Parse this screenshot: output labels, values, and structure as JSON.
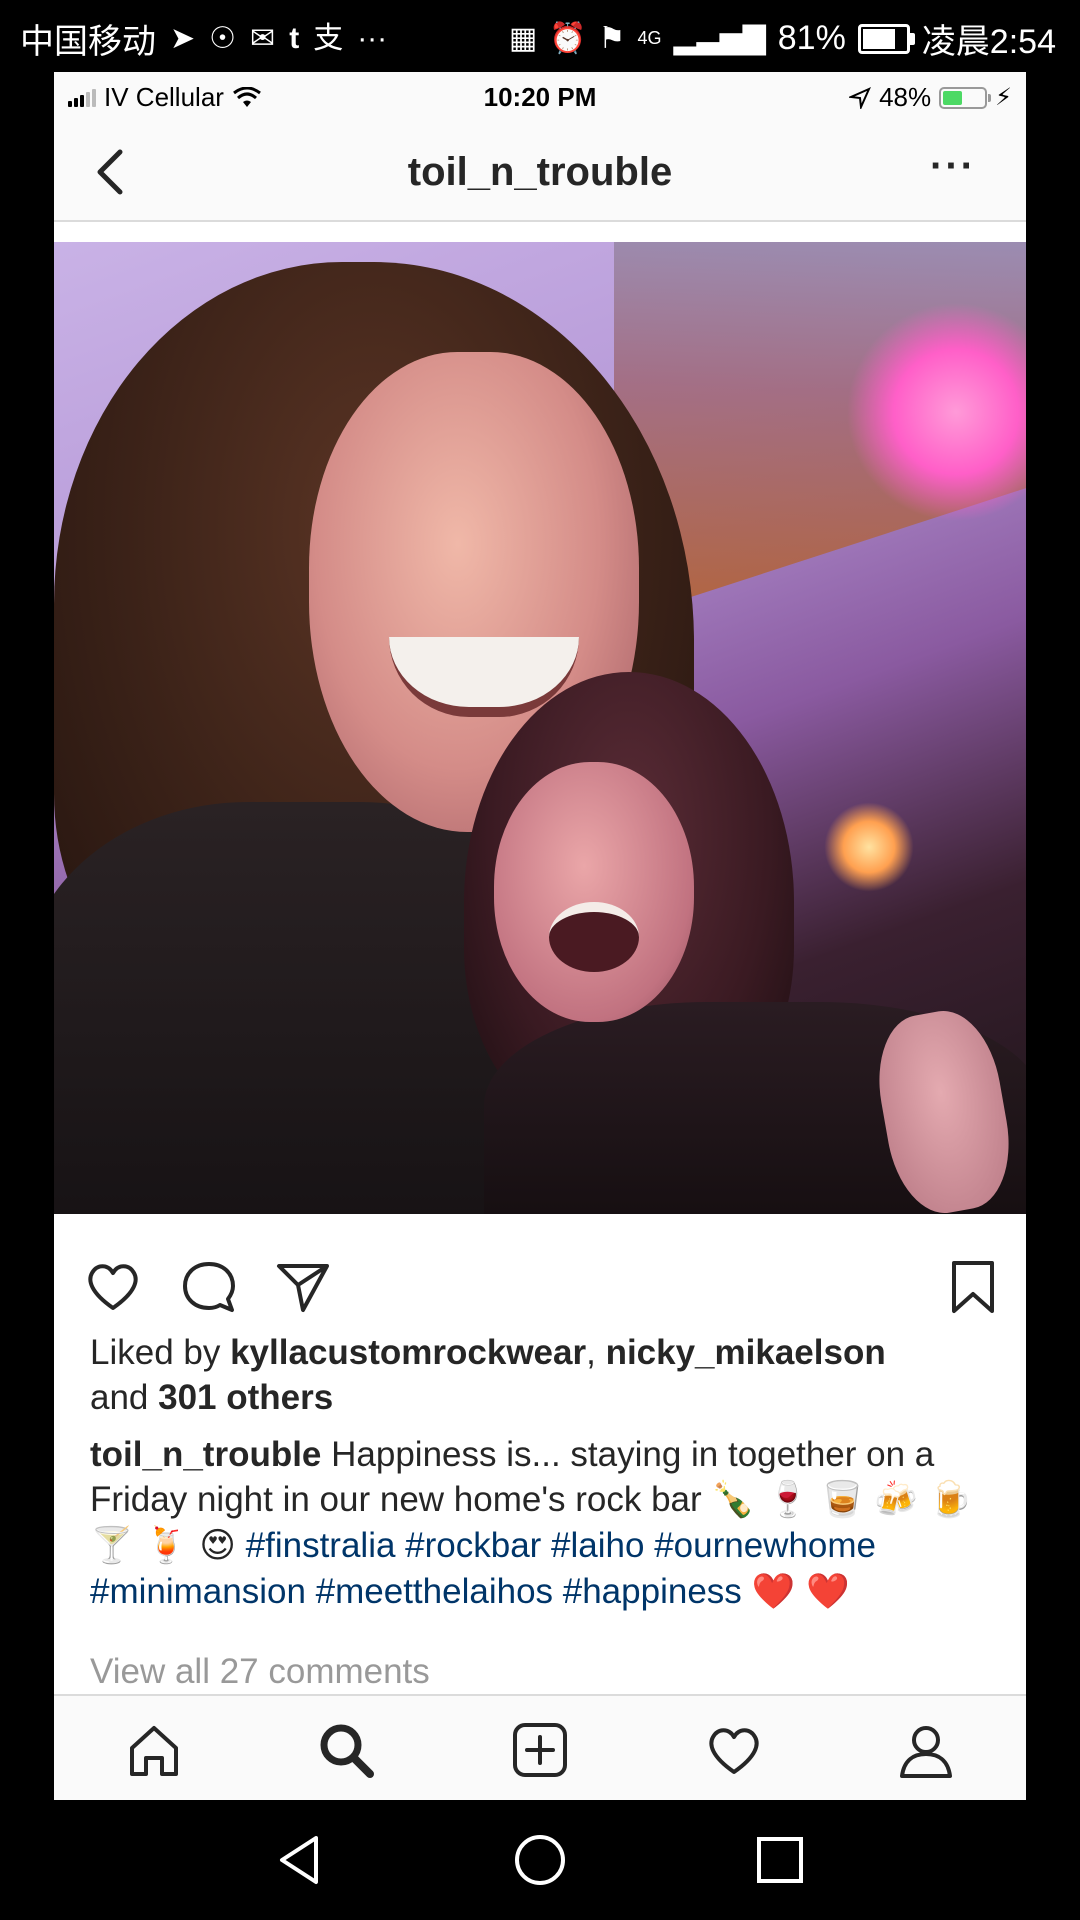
{
  "android_status": {
    "carrier": "中国移动",
    "left_icons": [
      "paper-plane-icon",
      "weibo-icon",
      "mail-icon",
      "tumblr-icon",
      "alipay-icon",
      "more-notifications-icon"
    ],
    "overflow": "···",
    "battery_pct": "81%",
    "battery_fill": 0.81,
    "time": "凌晨2:54",
    "network": "4G"
  },
  "ios_status": {
    "carrier": "IV Cellular",
    "time": "10:20 PM",
    "battery_pct": "48%",
    "battery_fill": 0.48,
    "battery_color": "#4cd964"
  },
  "header": {
    "title": "toil_n_trouble",
    "more": "···"
  },
  "post": {
    "likes_prefix": "Liked by ",
    "liker1": "kyllacustomrockwear",
    "likes_sep": ", ",
    "liker2": "nicky_mikaelson",
    "likes_and": "and ",
    "others": "301 others",
    "caption_user": "toil_n_trouble",
    "caption_text": " Happiness is... staying in together on a Friday night in our new home's rock bar ",
    "caption_emojis_1": "🍾 🍷 🥃",
    "caption_emojis_2": "🍻 🍺 🍸 🍹 😍",
    "hashtags": "#finstralia #rockbar #laiho #ournewhome #minimansion #meetthelaihos #happiness",
    "caption_hearts": "❤️ ❤️",
    "comments_link": "View all 27 comments"
  },
  "colors": {
    "hashtag": "#003569",
    "text": "#262626",
    "muted": "#999999",
    "divider": "#dbdbdb"
  }
}
